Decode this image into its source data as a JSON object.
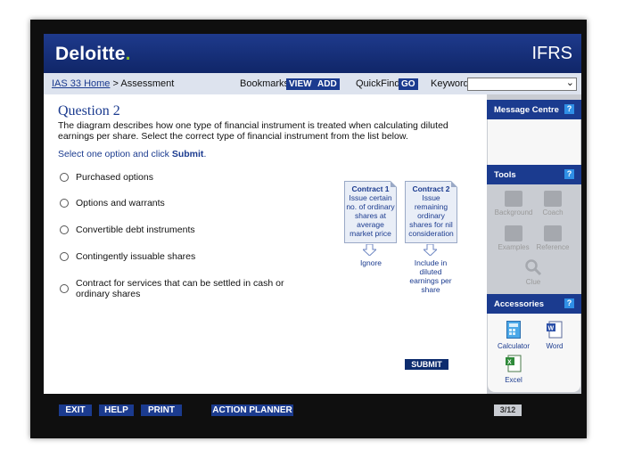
{
  "header": {
    "logo": "Deloitte",
    "logo_dot": ".",
    "product": "IFRS"
  },
  "nav": {
    "home_link": "IAS 33 Home",
    "breadcrumb_sep": " > ",
    "current": "Assessment",
    "bookmarks_label": "Bookmarks:",
    "view_btn": "VIEW",
    "add_btn": "ADD",
    "quickfind_label": "QuickFind:",
    "go_btn": "GO",
    "keyword_label": "Keyword:",
    "keyword_value": ""
  },
  "question": {
    "title": "Question 2",
    "text": "The diagram describes how one type of financial instrument is treated when calculating diluted earnings per share. Select the correct type of financial instrument from the list below.",
    "instruction_prefix": "Select one option and click ",
    "instruction_action": "Submit",
    "instruction_suffix": ".",
    "options": [
      "Purchased options",
      "Options and warrants",
      "Convertible debt instruments",
      "Contingently issuable shares",
      "Contract for services that can be settled in cash or ordinary shares"
    ],
    "submit": "SUBMIT"
  },
  "diagram": {
    "contract1_title": "Contract 1",
    "contract1_text": "Issue certain no. of ordinary shares at average market price",
    "contract1_result": "Ignore",
    "contract2_title": "Contract 2",
    "contract2_text": "Issue remaining ordinary shares for nil consideration",
    "contract2_result": "Include in diluted earnings per share"
  },
  "sidebar": {
    "message_centre": "Message Centre",
    "tools": "Tools",
    "tool_items": [
      "Background",
      "Coach",
      "Examples",
      "Reference",
      "Clue"
    ],
    "accessories": "Accessories",
    "accessory_items": [
      "Calculator",
      "Word",
      "Excel"
    ],
    "help_glyph": "?"
  },
  "footer": {
    "exit": "EXIT",
    "help": "HELP",
    "print": "PRINT",
    "action_planner": "ACTION PLANNER",
    "page_indicator": "3/12"
  },
  "colors": {
    "brand_blue": "#1b3b8f",
    "header_blue": "#102668",
    "deloitte_green": "#86bc25",
    "help_blue": "#2f8fe6"
  }
}
